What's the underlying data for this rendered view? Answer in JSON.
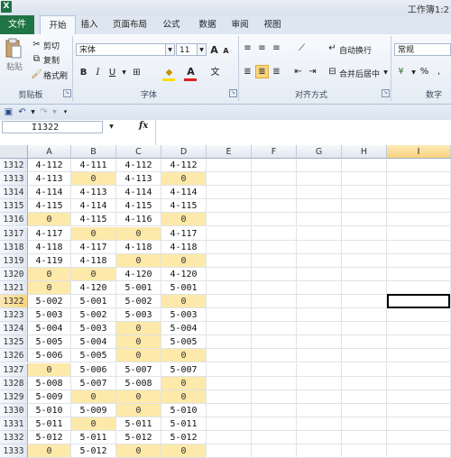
{
  "title": "工作簿1:2",
  "app_icon": "X",
  "tabs": [
    {
      "label": "文件",
      "key": "file"
    },
    {
      "label": "开始",
      "key": "home"
    },
    {
      "label": "插入",
      "key": "insert"
    },
    {
      "label": "页面布局",
      "key": "layout"
    },
    {
      "label": "公式",
      "key": "formulas"
    },
    {
      "label": "数据",
      "key": "data"
    },
    {
      "label": "审阅",
      "key": "review"
    },
    {
      "label": "视图",
      "key": "view"
    }
  ],
  "ribbon": {
    "clipboard": {
      "paste": "粘贴",
      "cut": "剪切",
      "copy": "复制",
      "format_painter": "格式刷",
      "group": "剪贴板"
    },
    "font": {
      "name": "宋体",
      "size": "11",
      "grow": "A",
      "shrink": "A",
      "bold": "B",
      "italic": "I",
      "underline": "U",
      "group": "字体"
    },
    "alignment": {
      "wrap": "自动换行",
      "merge": "合并后居中",
      "group": "对齐方式"
    },
    "number": {
      "format": "常规",
      "percent": "%",
      "comma": ",",
      "group": "数字"
    }
  },
  "formula_bar": {
    "name_box": "I1322",
    "fx": "fx",
    "value": ""
  },
  "columns": [
    "A",
    "B",
    "C",
    "D",
    "E",
    "F",
    "G",
    "H",
    "I"
  ],
  "selected_column": "I",
  "selected_row": "1322",
  "rows": [
    {
      "n": "1312",
      "cells": [
        "4-112",
        "4-111",
        "4-112",
        "4-112"
      ]
    },
    {
      "n": "1313",
      "cells": [
        "4-113",
        "0",
        "4-113",
        "0"
      ]
    },
    {
      "n": "1314",
      "cells": [
        "4-114",
        "4-113",
        "4-114",
        "4-114"
      ]
    },
    {
      "n": "1315",
      "cells": [
        "4-115",
        "4-114",
        "4-115",
        "4-115"
      ]
    },
    {
      "n": "1316",
      "cells": [
        "0",
        "4-115",
        "4-116",
        "0"
      ]
    },
    {
      "n": "1317",
      "cells": [
        "4-117",
        "0",
        "0",
        "4-117"
      ]
    },
    {
      "n": "1318",
      "cells": [
        "4-118",
        "4-117",
        "4-118",
        "4-118"
      ]
    },
    {
      "n": "1319",
      "cells": [
        "4-119",
        "4-118",
        "0",
        "0"
      ]
    },
    {
      "n": "1320",
      "cells": [
        "0",
        "0",
        "4-120",
        "4-120"
      ]
    },
    {
      "n": "1321",
      "cells": [
        "0",
        "4-120",
        "5-001",
        "5-001"
      ]
    },
    {
      "n": "1322",
      "cells": [
        "5-002",
        "5-001",
        "5-002",
        "0"
      ]
    },
    {
      "n": "1323",
      "cells": [
        "5-003",
        "5-002",
        "5-003",
        "5-003"
      ]
    },
    {
      "n": "1324",
      "cells": [
        "5-004",
        "5-003",
        "0",
        "5-004"
      ]
    },
    {
      "n": "1325",
      "cells": [
        "5-005",
        "5-004",
        "0",
        "5-005"
      ]
    },
    {
      "n": "1326",
      "cells": [
        "5-006",
        "5-005",
        "0",
        "0"
      ]
    },
    {
      "n": "1327",
      "cells": [
        "0",
        "5-006",
        "5-007",
        "5-007"
      ]
    },
    {
      "n": "1328",
      "cells": [
        "5-008",
        "5-007",
        "5-008",
        "0"
      ]
    },
    {
      "n": "1329",
      "cells": [
        "5-009",
        "0",
        "0",
        "0"
      ]
    },
    {
      "n": "1330",
      "cells": [
        "5-010",
        "5-009",
        "0",
        "5-010"
      ]
    },
    {
      "n": "1331",
      "cells": [
        "5-011",
        "0",
        "5-011",
        "5-011"
      ]
    },
    {
      "n": "1332",
      "cells": [
        "5-012",
        "5-011",
        "5-012",
        "5-012"
      ]
    },
    {
      "n": "1333",
      "cells": [
        "0",
        "5-012",
        "0",
        "0"
      ]
    }
  ]
}
